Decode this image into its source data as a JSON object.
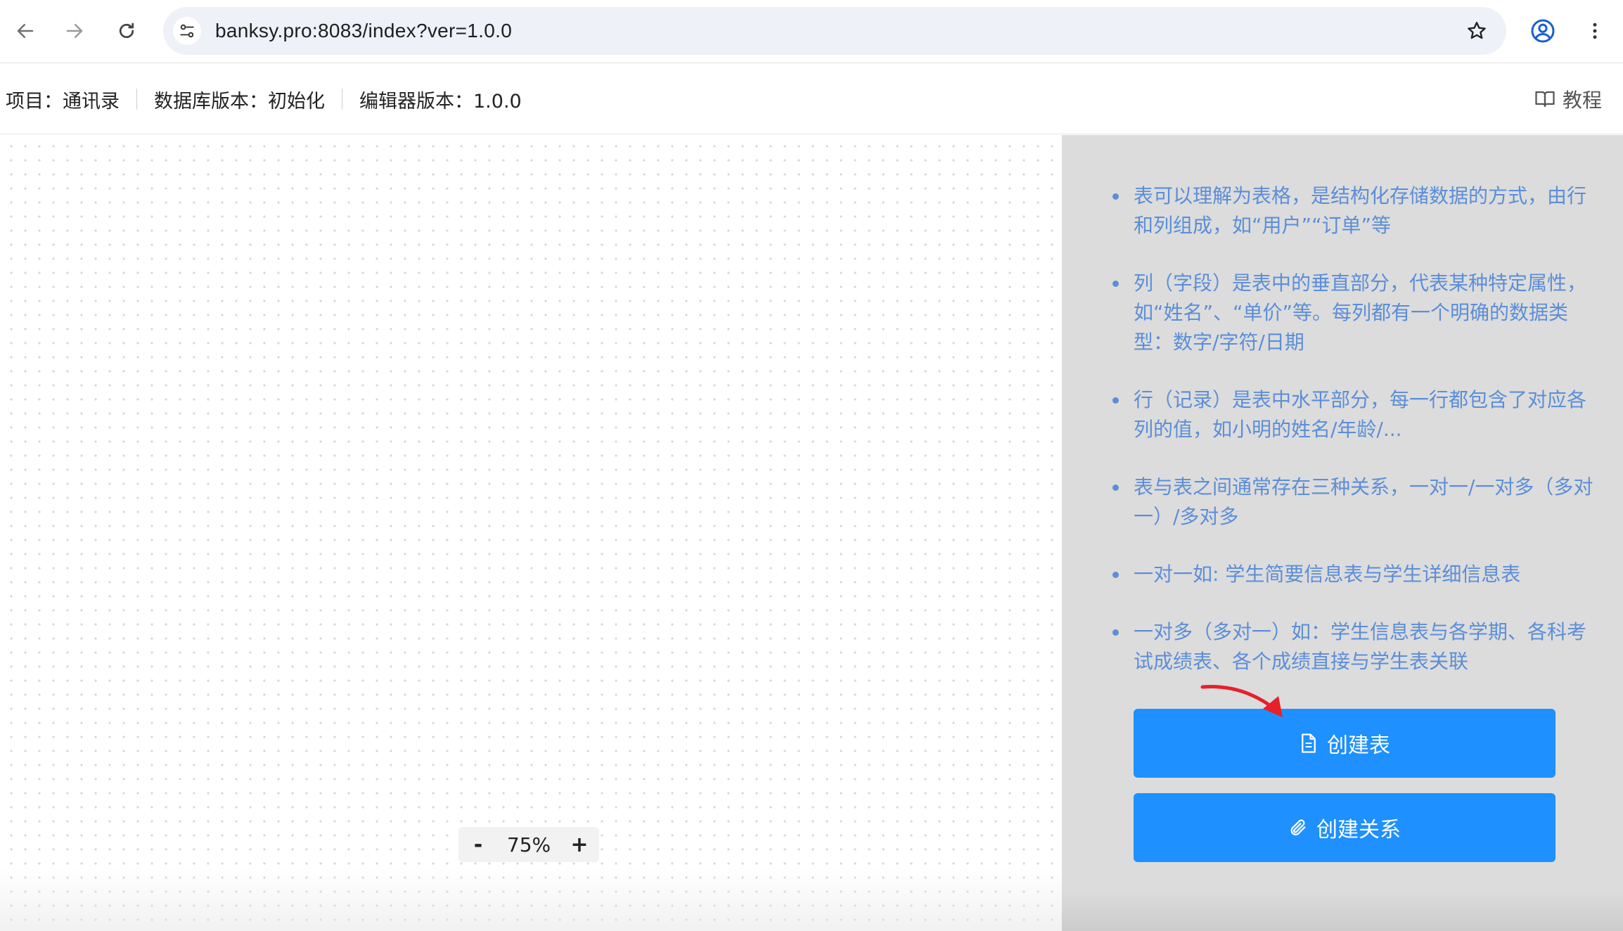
{
  "browser": {
    "url": "banksy.pro:8083/index?ver=1.0.0",
    "icons": {
      "back": "arrow-left-icon",
      "forward": "arrow-right-icon",
      "reload": "reload-icon",
      "site_info": "tune-icon",
      "bookmark": "star-icon",
      "profile": "account-circle-icon",
      "menu": "more-vertical-icon"
    }
  },
  "header": {
    "project": "项目：通讯录",
    "db_version": "数据库版本：初始化",
    "editor_version": "编辑器版本：1.0.0",
    "tutorial_label": "教程"
  },
  "canvas": {
    "zoom_minus": "-",
    "zoom_value": "75%",
    "zoom_plus": "+"
  },
  "panel": {
    "tips": [
      "表可以理解为表格，是结构化存储数据的方式，由行和列组成，如“用户”“订单”等",
      "列（字段）是表中的垂直部分，代表某种特定属性，如“姓名”、“单价”等。每列都有一个明确的数据类型：数字/字符/日期",
      "行（记录）是表中水平部分，每一行都包含了对应各列的值，如小明的姓名/年龄/...",
      "表与表之间通常存在三种关系，一对一/一对多（多对一）/多对多",
      "一对一如: 学生简要信息表与学生详细信息表",
      "一对多（多对一）如：学生信息表与各学期、各科考试成绩表、各个成绩直接与学生表关联"
    ],
    "create_table_label": "创建表",
    "create_relation_label": "创建关系"
  },
  "colors": {
    "primary_button": "#1e90ff",
    "tip_text": "#5b8ed8",
    "panel_bg": "#dcdcdc",
    "annotation_arrow": "#e8202a"
  }
}
